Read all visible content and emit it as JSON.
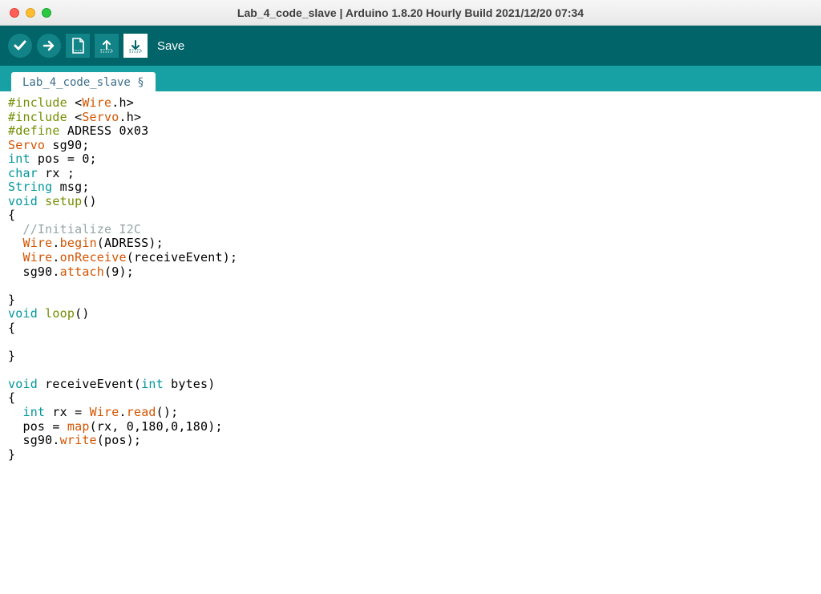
{
  "window": {
    "title": "Lab_4_code_slave | Arduino 1.8.20 Hourly Build 2021/12/20 07:34"
  },
  "toolbar": {
    "save_label": "Save"
  },
  "tabs": [
    {
      "label": "Lab_4_code_slave §"
    }
  ],
  "code": {
    "l1_a": "#include",
    "l1_b": " <",
    "l1_c": "Wire",
    "l1_d": ".h>",
    "l2_a": "#include",
    "l2_b": " <",
    "l2_c": "Servo",
    "l2_d": ".h>",
    "l3_a": "#define",
    "l3_b": " ADRESS 0x03",
    "l4_a": "Servo",
    "l4_b": " sg90;",
    "l5_a": "int",
    "l5_b": " pos = 0;",
    "l6_a": "char",
    "l6_b": " rx ;",
    "l7_a": "String",
    "l7_b": " msg;",
    "l8_a": "void",
    "l8_b": " ",
    "l8_c": "setup",
    "l8_d": "()",
    "l9": "{",
    "l10_a": "  ",
    "l10_b": "//Initialize I2C",
    "l11_a": "  ",
    "l11_b": "Wire",
    "l11_c": ".",
    "l11_d": "begin",
    "l11_e": "(ADRESS);",
    "l12_a": "  ",
    "l12_b": "Wire",
    "l12_c": ".",
    "l12_d": "onReceive",
    "l12_e": "(receiveEvent);",
    "l13_a": "  sg90.",
    "l13_b": "attach",
    "l13_c": "(9);",
    "l14": "",
    "l15": "}",
    "l16_a": "void",
    "l16_b": " ",
    "l16_c": "loop",
    "l16_d": "()",
    "l17": "{",
    "l18": "",
    "l19": "}",
    "l20": "",
    "l21_a": "void",
    "l21_b": " receiveEvent(",
    "l21_c": "int",
    "l21_d": " bytes)",
    "l22": "{",
    "l23_a": "  ",
    "l23_b": "int",
    "l23_c": " rx = ",
    "l23_d": "Wire",
    "l23_e": ".",
    "l23_f": "read",
    "l23_g": "();",
    "l24_a": "  pos = ",
    "l24_b": "map",
    "l24_c": "(rx, 0,180,0,180);",
    "l25_a": "  sg90.",
    "l25_b": "write",
    "l25_c": "(pos);",
    "l26": "}"
  }
}
